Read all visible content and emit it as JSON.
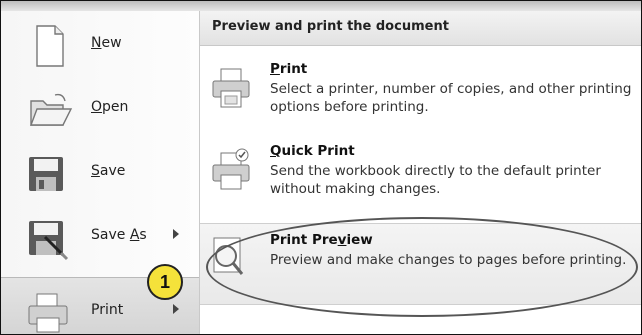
{
  "menu": {
    "items": [
      {
        "label": "New",
        "key": "N",
        "icon": "new-document-icon"
      },
      {
        "label": "Open",
        "key": "O",
        "icon": "open-folder-icon"
      },
      {
        "label": "Save",
        "key": "S",
        "icon": "save-disk-icon"
      },
      {
        "label": "Save As",
        "key": "A",
        "icon": "save-as-icon",
        "has_submenu": true
      },
      {
        "label": "Print",
        "key": "",
        "icon": "printer-icon",
        "has_submenu": true,
        "active": true
      }
    ]
  },
  "submenu": {
    "header": "Preview and print the document",
    "options": [
      {
        "title": "Print",
        "key": "P",
        "description": "Select a printer, number of copies, and other printing options before printing.",
        "icon": "printer-icon"
      },
      {
        "title": "Quick Print",
        "key": "Q",
        "description": "Send the workbook directly to the default printer without making changes.",
        "icon": "quick-print-icon"
      },
      {
        "title": "Print Preview",
        "key": "v",
        "description": "Preview and make changes to pages before printing.",
        "icon": "print-preview-icon",
        "highlighted": true
      }
    ]
  },
  "annotation": {
    "badge": "1",
    "badge_color": "#f5e23a"
  },
  "colors": {
    "header_bg": "#e6e6e6",
    "active_bg": "#d8d8d8",
    "outline": "#555555"
  }
}
